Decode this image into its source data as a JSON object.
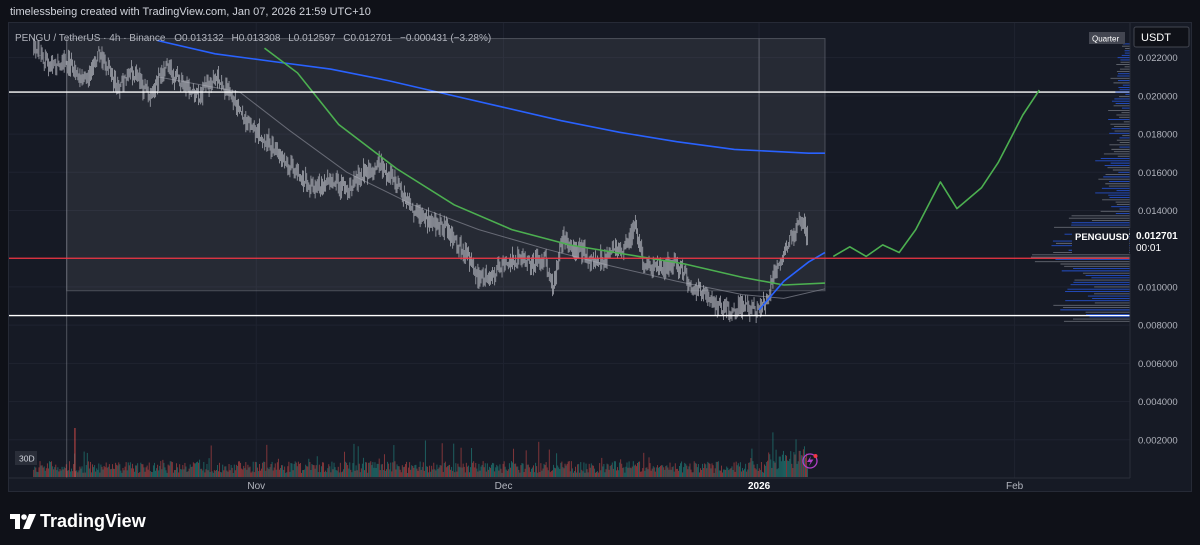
{
  "header": {
    "credit": "timelessbeing created with TradingView.com, Jan 07, 2026 21:59 UTC+10"
  },
  "legend": {
    "symbol": "PENGU / TetherUS · 4h · Binance",
    "open": "O0.013132",
    "high": "H0.013308",
    "low": "L0.012597",
    "close": "C0.012701",
    "change": "−0.000431 (−3.28%)"
  },
  "price_axis": {
    "currency": "USDT",
    "profile_label": "Quarter",
    "last_symbol": "PENGUUSDT",
    "last_price": "0.012701",
    "countdown": "00:01"
  },
  "time_axis": {
    "range_badge": "30D"
  },
  "footer": {
    "brand": "TradingView"
  },
  "colors": {
    "background": "#161a25",
    "up": "#26a69a",
    "down": "#ef5350",
    "candle": "#b2b5be",
    "ma_slow": "#2962ff",
    "ma_fast": "#4caf50",
    "projection": "#4caf50",
    "support": "#ffffff",
    "pivot": "#f23645",
    "volume_profile": "#2962ff"
  },
  "chart_data": {
    "type": "candlestick",
    "symbol": "PENGUUSDT",
    "exchange": "Binance",
    "interval": "4h",
    "ylim": [
      0,
      0.0235
    ],
    "y_ticks": [
      "0.022000",
      "0.020000",
      "0.018000",
      "0.016000",
      "0.014000",
      "0.010000",
      "0.008000",
      "0.006000",
      "0.004000",
      "0.002000"
    ],
    "x_labels": [
      {
        "label": "Nov",
        "date": "2025-11-01"
      },
      {
        "label": "Dec",
        "date": "2025-12-01"
      },
      {
        "label": "2026",
        "date": "2026-01-01"
      },
      {
        "label": "Feb",
        "date": "2026-02-01"
      }
    ],
    "x_domain": [
      "2025-10-02",
      "2026-02-15"
    ],
    "price_path": [
      {
        "date": "2025-10-05",
        "price": 0.0228
      },
      {
        "date": "2025-10-07",
        "price": 0.0215
      },
      {
        "date": "2025-10-09",
        "price": 0.0218
      },
      {
        "date": "2025-10-11",
        "price": 0.0207
      },
      {
        "date": "2025-10-13",
        "price": 0.0222
      },
      {
        "date": "2025-10-15",
        "price": 0.0205
      },
      {
        "date": "2025-10-17",
        "price": 0.0212
      },
      {
        "date": "2025-10-19",
        "price": 0.02
      },
      {
        "date": "2025-10-21",
        "price": 0.0215
      },
      {
        "date": "2025-10-23",
        "price": 0.0207
      },
      {
        "date": "2025-10-25",
        "price": 0.02
      },
      {
        "date": "2025-10-27",
        "price": 0.0212
      },
      {
        "date": "2025-10-29",
        "price": 0.02
      },
      {
        "date": "2025-10-31",
        "price": 0.0185
      },
      {
        "date": "2025-11-02",
        "price": 0.0178
      },
      {
        "date": "2025-11-04",
        "price": 0.0168
      },
      {
        "date": "2025-11-06",
        "price": 0.016
      },
      {
        "date": "2025-11-08",
        "price": 0.015
      },
      {
        "date": "2025-11-10",
        "price": 0.0157
      },
      {
        "date": "2025-11-12",
        "price": 0.015
      },
      {
        "date": "2025-11-14",
        "price": 0.016
      },
      {
        "date": "2025-11-16",
        "price": 0.0165
      },
      {
        "date": "2025-11-18",
        "price": 0.0153
      },
      {
        "date": "2025-11-20",
        "price": 0.014
      },
      {
        "date": "2025-11-22",
        "price": 0.0135
      },
      {
        "date": "2025-11-24",
        "price": 0.013
      },
      {
        "date": "2025-11-26",
        "price": 0.012
      },
      {
        "date": "2025-11-28",
        "price": 0.0105
      },
      {
        "date": "2025-11-30",
        "price": 0.0107
      },
      {
        "date": "2025-12-02",
        "price": 0.0115
      },
      {
        "date": "2025-12-04",
        "price": 0.0113
      },
      {
        "date": "2025-12-06",
        "price": 0.0115
      },
      {
        "date": "2025-12-07",
        "price": 0.0098
      },
      {
        "date": "2025-12-08",
        "price": 0.0125
      },
      {
        "date": "2025-12-10",
        "price": 0.012
      },
      {
        "date": "2025-12-12",
        "price": 0.0113
      },
      {
        "date": "2025-12-14",
        "price": 0.0118
      },
      {
        "date": "2025-12-16",
        "price": 0.0122
      },
      {
        "date": "2025-12-17",
        "price": 0.0132
      },
      {
        "date": "2025-12-18",
        "price": 0.0112
      },
      {
        "date": "2025-12-20",
        "price": 0.011
      },
      {
        "date": "2025-12-22",
        "price": 0.0112
      },
      {
        "date": "2025-12-24",
        "price": 0.01
      },
      {
        "date": "2025-12-26",
        "price": 0.0093
      },
      {
        "date": "2025-12-28",
        "price": 0.0088
      },
      {
        "date": "2025-12-30",
        "price": 0.009
      },
      {
        "date": "2026-01-01",
        "price": 0.0087
      },
      {
        "date": "2026-01-02",
        "price": 0.0093
      },
      {
        "date": "2026-01-03",
        "price": 0.011
      },
      {
        "date": "2026-01-05",
        "price": 0.0128
      },
      {
        "date": "2026-01-06",
        "price": 0.0135
      },
      {
        "date": "2026-01-07",
        "price": 0.0127
      }
    ],
    "series": [
      {
        "name": "MA slow",
        "color": "#2962ff",
        "points": [
          {
            "date": "2025-10-20",
            "price": 0.0229
          },
          {
            "date": "2025-10-27",
            "price": 0.0222
          },
          {
            "date": "2025-11-03",
            "price": 0.0218
          },
          {
            "date": "2025-11-10",
            "price": 0.0214
          },
          {
            "date": "2025-11-17",
            "price": 0.0208
          },
          {
            "date": "2025-11-24",
            "price": 0.0201
          },
          {
            "date": "2025-12-01",
            "price": 0.0194
          },
          {
            "date": "2025-12-08",
            "price": 0.0187
          },
          {
            "date": "2025-12-15",
            "price": 0.0181
          },
          {
            "date": "2025-12-22",
            "price": 0.0176
          },
          {
            "date": "2025-12-29",
            "price": 0.0172
          },
          {
            "date": "2026-01-07",
            "price": 0.017
          },
          {
            "date": "2026-01-09",
            "price": 0.017
          }
        ]
      },
      {
        "name": "MA fast",
        "color": "#4caf50",
        "points": [
          {
            "date": "2025-11-02",
            "price": 0.0225
          },
          {
            "date": "2025-11-06",
            "price": 0.0212
          },
          {
            "date": "2025-11-11",
            "price": 0.0185
          },
          {
            "date": "2025-11-18",
            "price": 0.0162
          },
          {
            "date": "2025-11-25",
            "price": 0.0143
          },
          {
            "date": "2025-12-02",
            "price": 0.013
          },
          {
            "date": "2025-12-09",
            "price": 0.0122
          },
          {
            "date": "2025-12-16",
            "price": 0.0117
          },
          {
            "date": "2025-12-23",
            "price": 0.0112
          },
          {
            "date": "2025-12-30",
            "price": 0.0105
          },
          {
            "date": "2026-01-04",
            "price": 0.0101
          },
          {
            "date": "2026-01-09",
            "price": 0.0102
          }
        ]
      },
      {
        "name": "Band lower",
        "color": "#787b86",
        "points": [
          {
            "date": "2025-10-20",
            "price": 0.021
          },
          {
            "date": "2025-10-30",
            "price": 0.0202
          },
          {
            "date": "2025-11-05",
            "price": 0.0182
          },
          {
            "date": "2025-11-12",
            "price": 0.016
          },
          {
            "date": "2025-11-20",
            "price": 0.0143
          },
          {
            "date": "2025-11-28",
            "price": 0.013
          },
          {
            "date": "2025-12-06",
            "price": 0.012
          },
          {
            "date": "2025-12-14",
            "price": 0.0111
          },
          {
            "date": "2025-12-22",
            "price": 0.0103
          },
          {
            "date": "2025-12-30",
            "price": 0.0096
          },
          {
            "date": "2026-01-04",
            "price": 0.0094
          },
          {
            "date": "2026-01-09",
            "price": 0.0099
          }
        ]
      },
      {
        "name": "MA short",
        "color": "#2962ff",
        "points": [
          {
            "date": "2026-01-01",
            "price": 0.0088
          },
          {
            "date": "2026-01-04",
            "price": 0.0103
          },
          {
            "date": "2026-01-07",
            "price": 0.0113
          },
          {
            "date": "2026-01-09",
            "price": 0.0118
          }
        ]
      }
    ],
    "projection": [
      {
        "date": "2026-01-10",
        "price": 0.0116
      },
      {
        "date": "2026-01-12",
        "price": 0.0121
      },
      {
        "date": "2026-01-14",
        "price": 0.0116
      },
      {
        "date": "2026-01-16",
        "price": 0.0122
      },
      {
        "date": "2026-01-18",
        "price": 0.0118
      },
      {
        "date": "2026-01-20",
        "price": 0.013
      },
      {
        "date": "2026-01-23",
        "price": 0.0155
      },
      {
        "date": "2026-01-25",
        "price": 0.0141
      },
      {
        "date": "2026-01-28",
        "price": 0.0152
      },
      {
        "date": "2026-01-30",
        "price": 0.0165
      },
      {
        "date": "2026-02-02",
        "price": 0.019
      },
      {
        "date": "2026-02-04",
        "price": 0.0203
      }
    ],
    "horizontal_levels": [
      {
        "name": "resistance",
        "price": 0.0202,
        "color": "#ffffff"
      },
      {
        "name": "pivot",
        "price": 0.0115,
        "color": "#f23645"
      },
      {
        "name": "support",
        "price": 0.0085,
        "color": "#ffffff"
      }
    ],
    "last_price": 0.012701,
    "volume_profile": "visible on right edge, densest between 0.0085 and 0.0135"
  }
}
